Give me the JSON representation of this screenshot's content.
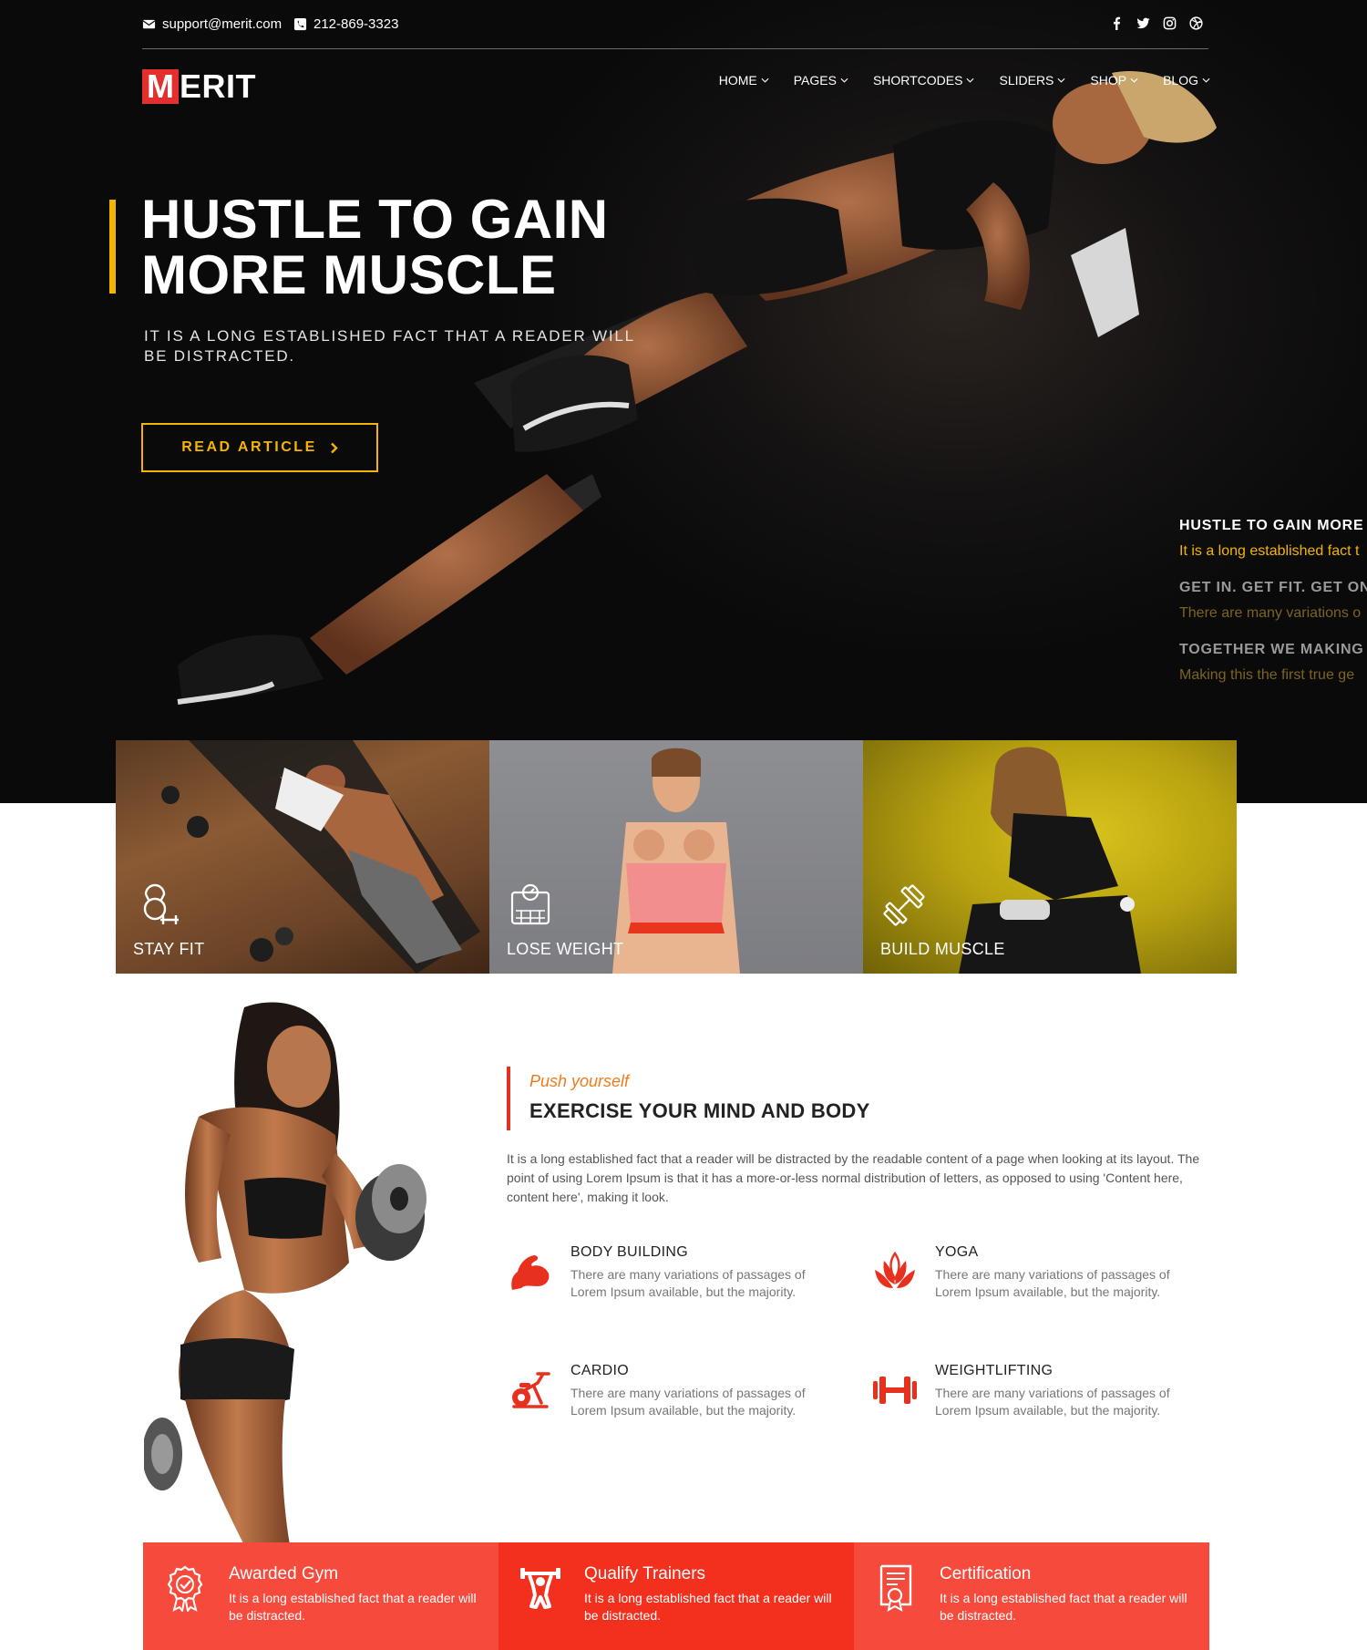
{
  "topbar": {
    "email": "support@merit.com",
    "phone": "212-869-3323",
    "social_icons": [
      "facebook-icon",
      "twitter-icon",
      "instagram-icon",
      "dribbble-icon"
    ]
  },
  "logo": {
    "initial": "M",
    "rest": "ERIT",
    "accent_color": "#e52f2f"
  },
  "nav": {
    "items": [
      {
        "label": "HOME"
      },
      {
        "label": "PAGES"
      },
      {
        "label": "SHORTCODES"
      },
      {
        "label": "SLIDERS"
      },
      {
        "label": "SHOP"
      },
      {
        "label": "BLOG"
      }
    ]
  },
  "hero": {
    "title_line1": "HUSTLE TO GAIN",
    "title_line2": "MORE MUSCLE",
    "subtitle": "IT IS A LONG ESTABLISHED FACT THAT A READER WILL BE DISTRACTED.",
    "button_label": "READ ARTICLE",
    "accent_color": "#f5b400",
    "slides": [
      {
        "title": "HUSTLE TO GAIN MORE",
        "desc": "It is a long established fact t",
        "active": true
      },
      {
        "title": "GET IN. GET FIT. GET ON",
        "desc": "There are many variations o",
        "active": false
      },
      {
        "title": "TOGETHER WE MAKING",
        "desc": "Making this the first true ge",
        "active": false
      }
    ]
  },
  "tiles": [
    {
      "label": "STAY FIT",
      "icon": "kettlebell-icon"
    },
    {
      "label": "LOSE WEIGHT",
      "icon": "scale-icon"
    },
    {
      "label": "BUILD MUSCLE",
      "icon": "dumbbell-icon"
    }
  ],
  "about": {
    "kicker": "Push yourself",
    "title": "EXERCISE YOUR MIND AND BODY",
    "text": "It is a long established fact that a reader will be distracted by the readable content of a page when looking at its layout. The point of using Lorem Ipsum is that it has a more-or-less normal distribution of letters, as opposed to using 'Content here, content here', making it look.",
    "accent_color": "#e8301f",
    "services": [
      {
        "title": "BODY BUILDING",
        "text": "There are many variations of passages of Lorem Ipsum available, but the majority.",
        "icon": "flexed-arm-icon"
      },
      {
        "title": "YOGA",
        "text": "There are many variations of passages of Lorem Ipsum available, but the majority.",
        "icon": "lotus-icon"
      },
      {
        "title": "CARDIO",
        "text": "There are many variations of passages of Lorem Ipsum available, but the majority.",
        "icon": "exercise-bike-icon"
      },
      {
        "title": "WEIGHTLIFTING",
        "text": "There are many variations of passages of Lorem Ipsum available, but the majority.",
        "icon": "barbell-icon"
      }
    ]
  },
  "strip": [
    {
      "title": "Awarded Gym",
      "text": "It is a long established fact that a reader will be distracted.",
      "icon": "award-badge-icon"
    },
    {
      "title": "Qualify Trainers",
      "text": "It is a long established fact that a reader will be distracted.",
      "icon": "trainer-icon"
    },
    {
      "title": "Certification",
      "text": "It is a long established fact that a reader will be distracted.",
      "icon": "certificate-icon"
    }
  ]
}
